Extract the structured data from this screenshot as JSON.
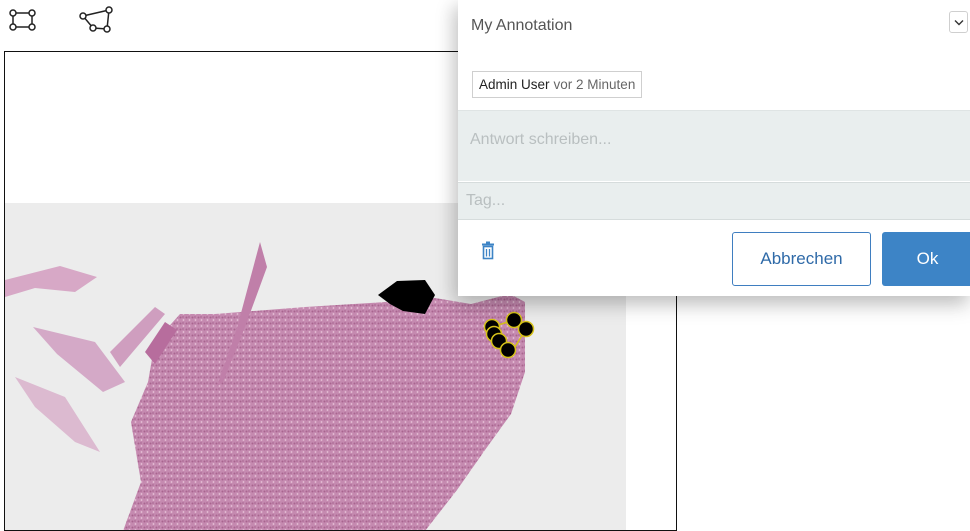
{
  "toolbar": {
    "tools": [
      {
        "name": "rectangle-tool",
        "icon": "rectangle-vertices-icon"
      },
      {
        "name": "polygon-tool",
        "icon": "polygon-vertices-icon"
      }
    ]
  },
  "viewer": {
    "annotation_color": "#111111",
    "point_outline_color": "#d6c21a"
  },
  "popup": {
    "title": "My Annotation",
    "dropdown_icon": "chevron-down-icon",
    "author_name": "Admin User",
    "author_time": "vor 2 Minuten",
    "reply_placeholder": "Antwort schreiben...",
    "tag_placeholder": "Tag...",
    "delete_icon": "trash-icon",
    "cancel_label": "Abbrechen",
    "ok_label": "Ok",
    "accent_color": "#3d84c6"
  }
}
